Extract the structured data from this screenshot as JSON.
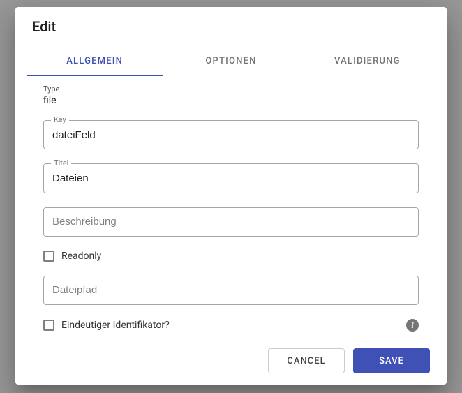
{
  "dialog": {
    "title": "Edit",
    "tabs": {
      "general": "ALLGEMEIN",
      "options": "OPTIONEN",
      "validation": "VALIDIERUNG"
    }
  },
  "form": {
    "type_label": "Type",
    "type_value": "file",
    "key_label": "Key",
    "key_value": "dateiFeld",
    "title_label": "Titel",
    "title_value": "Dateien",
    "description_placeholder": "Beschreibung",
    "readonly_label": "Readonly",
    "filepath_placeholder": "Dateipfad",
    "uniqueid_label": "Eindeutiger Identifikator?"
  },
  "actions": {
    "cancel": "CANCEL",
    "save": "SAVE"
  }
}
